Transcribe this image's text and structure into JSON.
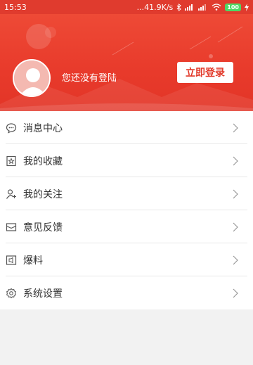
{
  "status": {
    "time": "15:53",
    "speed": "...41.9K/s",
    "battery": "100",
    "colors": {
      "bar": "#e03b2e"
    }
  },
  "header": {
    "login_hint": "您还没有登陆",
    "login_button": "立即登录",
    "colors": {
      "bg": "#e83a2b",
      "button_text": "#e23a2b"
    }
  },
  "menu": {
    "items": [
      {
        "label": "消息中心",
        "icon": "message-icon"
      },
      {
        "label": "我的收藏",
        "icon": "bookmark-icon"
      },
      {
        "label": "我的关注",
        "icon": "follow-user-icon"
      },
      {
        "label": "意见反馈",
        "icon": "feedback-mail-icon"
      },
      {
        "label": "爆料",
        "icon": "report-icon"
      },
      {
        "label": "系统设置",
        "icon": "settings-gear-icon"
      }
    ]
  }
}
